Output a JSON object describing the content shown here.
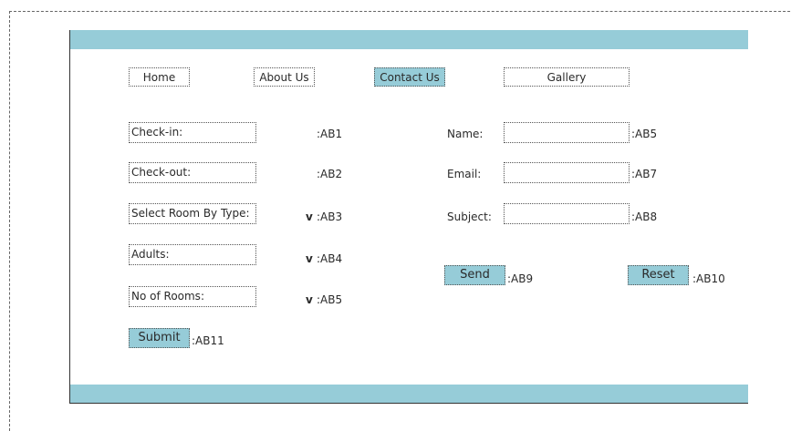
{
  "nav": {
    "home": "Home",
    "about": "About Us",
    "contact": "Contact Us",
    "gallery": "Gallery"
  },
  "booking": {
    "checkin": {
      "label": "Check-in:",
      "ref": ":AB1"
    },
    "checkout": {
      "label": "Check-out:",
      "ref": ":AB2"
    },
    "room_type": {
      "label": "Select Room By Type:",
      "arrow": "v",
      "ref": ":AB3"
    },
    "adults": {
      "label": "Adults:",
      "arrow": "v",
      "ref": ":AB4"
    },
    "rooms": {
      "label": "No of Rooms:",
      "arrow": "v",
      "ref": ":AB5"
    },
    "submit": {
      "label": "Submit",
      "ref": ":AB11"
    }
  },
  "contact": {
    "name": {
      "label": "Name:",
      "ref": ":AB5"
    },
    "email": {
      "label": "Email:",
      "ref": ":AB7"
    },
    "subject": {
      "label": "Subject:",
      "ref": ":AB8"
    },
    "send": {
      "label": "Send",
      "ref": ":AB9"
    },
    "reset": {
      "label": "Reset",
      "ref": ":AB10"
    }
  },
  "colors": {
    "accent": "#96ccd8"
  }
}
